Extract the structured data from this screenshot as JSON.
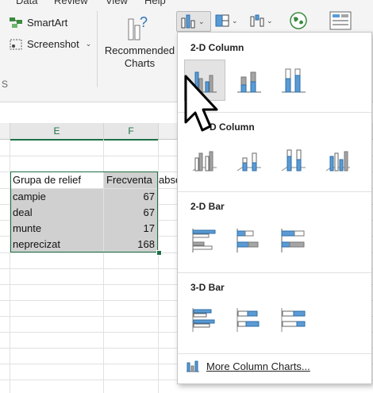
{
  "menu": {
    "data": "Data",
    "review": "Review",
    "view": "View",
    "help": "Help"
  },
  "ribbon": {
    "smartart": "SmartArt",
    "screenshot": "Screenshot",
    "recommended_charts_line1": "Recommended",
    "recommended_charts_line2": "Charts",
    "chevron": "⌄",
    "fragment_s": "S"
  },
  "grid": {
    "col_e": "E",
    "col_f": "F",
    "table": {
      "header": [
        "Grupa de relief",
        "Frecventa absoluta"
      ],
      "header_f_visible": "Frecventa",
      "header_overflow": "abso",
      "rows": [
        {
          "label": "campie",
          "value": "67"
        },
        {
          "label": "deal",
          "value": "67"
        },
        {
          "label": "munte",
          "value": "17"
        },
        {
          "label": "neprecizat",
          "value": "168"
        }
      ]
    }
  },
  "dropdown": {
    "sections": [
      {
        "title": "2-D Column"
      },
      {
        "title": "3-D Column"
      },
      {
        "title": "2-D Bar"
      },
      {
        "title": "3-D Bar"
      }
    ],
    "three_d_column_visible": "-D Column",
    "more_label": "More Column Charts...",
    "accent_blue": "#5b9bd5",
    "gray_bar": "#a5a5a5"
  }
}
